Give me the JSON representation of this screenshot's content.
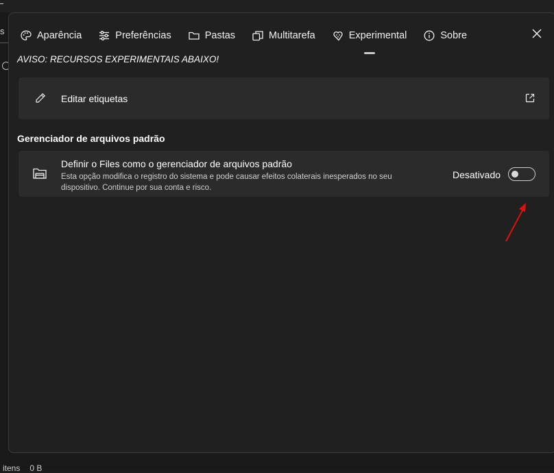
{
  "background": {
    "partial_tab_text": "s",
    "status_items": "itens",
    "status_size": "0 B"
  },
  "tabs": [
    {
      "label": "Aparência",
      "icon": "palette-icon"
    },
    {
      "label": "Preferências",
      "icon": "sliders-icon"
    },
    {
      "label": "Pastas",
      "icon": "folder-icon"
    },
    {
      "label": "Multitarefa",
      "icon": "multitask-icon"
    },
    {
      "label": "Experimental",
      "icon": "experimental-icon",
      "selected": true
    },
    {
      "label": "Sobre",
      "icon": "info-icon"
    }
  ],
  "warning": "AVISO: RECURSOS EXPERIMENTAIS ABAIXO!",
  "edit_tags": {
    "label": "Editar etiquetas",
    "icon": "pencil-icon",
    "action_icon": "external-link-icon"
  },
  "default_manager": {
    "section_title": "Gerenciador de arquivos padrão",
    "title": "Definir o Files como o gerenciador de arquivos padrão",
    "description": "Esta opção modifica o registro do sistema e pode causar efeitos colaterais inesperados no seu dispositivo. Continue por sua conta e risco.",
    "state_label": "Desativado",
    "toggle_on": false,
    "icon": "folder-open-icon"
  },
  "colors": {
    "dialog_bg": "#202020",
    "card_bg": "#2b2b2b",
    "annotation_arrow": "#e01010"
  }
}
